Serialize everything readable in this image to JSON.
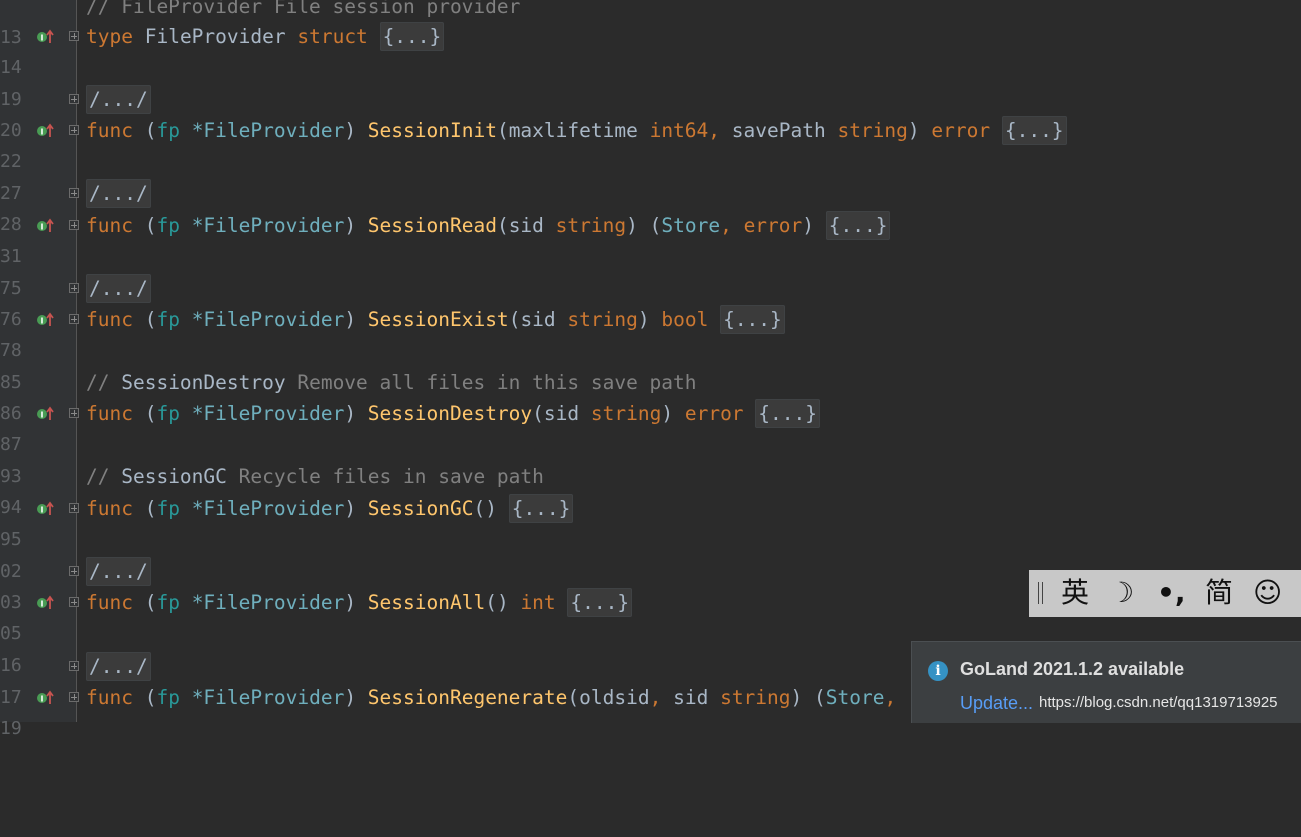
{
  "editor": {
    "lines": [
      {
        "num": "13",
        "text_comment": "// FileProvider File session provider"
      },
      {
        "num": "14",
        "kw": "type",
        "name": "FileProvider",
        "kw2": "struct",
        "fold": "{...}"
      },
      {
        "num": "19"
      },
      {
        "num": "20",
        "folded": "/.../"
      },
      {
        "num": "22",
        "func": "func",
        "recv": "fp",
        "recv_type": "*FileProvider",
        "method": "SessionInit",
        "p1": "maxlifetime",
        "t1": "int64",
        "p2": "savePath",
        "t2": "string",
        "ret": "error",
        "fold": "{...}"
      },
      {
        "num": "27"
      },
      {
        "num": "28",
        "folded": "/.../"
      },
      {
        "num": "31",
        "func": "func",
        "recv": "fp",
        "recv_type": "*FileProvider",
        "method": "SessionRead",
        "p1": "sid",
        "t1": "string",
        "ret1": "Store",
        "ret2": "error",
        "fold": "{...}"
      },
      {
        "num": "75"
      },
      {
        "num": "76",
        "folded": "/.../"
      },
      {
        "num": "78",
        "func": "func",
        "recv": "fp",
        "recv_type": "*FileProvider",
        "method": "SessionExist",
        "p1": "sid",
        "t1": "string",
        "ret": "bool",
        "fold": "{...}"
      },
      {
        "num": "85"
      },
      {
        "num": "86",
        "c_prefix": "// ",
        "c_name": "SessionDestroy",
        "c_rest": " Remove all files in this save path"
      },
      {
        "num": "87",
        "func": "func",
        "recv": "fp",
        "recv_type": "*FileProvider",
        "method": "SessionDestroy",
        "p1": "sid",
        "t1": "string",
        "ret": "error",
        "fold": "{...}"
      },
      {
        "num": "93"
      },
      {
        "num": "94",
        "c_prefix": "// ",
        "c_name": "SessionGC",
        "c_rest": " Recycle files in save path"
      },
      {
        "num": "95",
        "func": "func",
        "recv": "fp",
        "recv_type": "*FileProvider",
        "method": "SessionGC",
        "fold": "{...}"
      },
      {
        "num": "02"
      },
      {
        "num": "03",
        "folded": "/.../"
      },
      {
        "num": "05",
        "func": "func",
        "recv": "fp",
        "recv_type": "*FileProvider",
        "method": "SessionAll",
        "ret": "int",
        "fold": "{...}"
      },
      {
        "num": "16"
      },
      {
        "num": "17",
        "folded": "/.../"
      },
      {
        "num": "19",
        "func": "func",
        "recv": "fp",
        "recv_type": "*FileProvider",
        "method": "SessionRegenerate",
        "p1": "oldsid",
        "p2": "sid",
        "t2": "string",
        "ret1": "Store"
      }
    ]
  },
  "ime": {
    "lang": "英",
    "moon": "☽",
    "punct": "•,",
    "script": "简",
    "emoji": "☺"
  },
  "notification": {
    "title": "GoLand 2021.1.2 available",
    "action": "Update...",
    "watermark": "https://blog.csdn.net/qq1319713925"
  },
  "colors": {
    "background": "#2b2b2b",
    "keyword": "#cc7832",
    "function": "#ffc66d",
    "receiver": "#299999",
    "comment": "#808080",
    "link": "#589df6"
  }
}
